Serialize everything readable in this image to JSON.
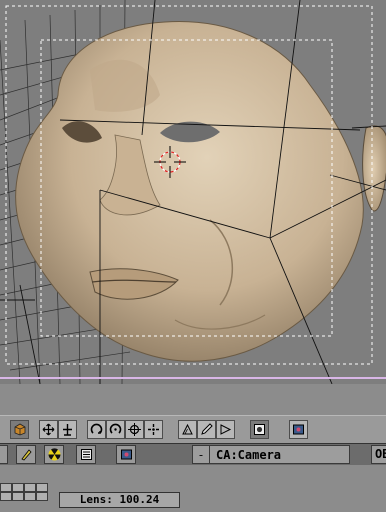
{
  "viewport": {
    "active_view": "camera",
    "object": "head-mesh"
  },
  "toolbar": {
    "icons": [
      "object-cube-icon",
      "grab-move-icon",
      "scale-icon",
      "rotate-icon",
      "rotate-local-icon",
      "center-icon",
      "snap-icon",
      "proportional-icon",
      "pencil-icon",
      "wedge-icon",
      "render-icon",
      "image-icon"
    ]
  },
  "infobar": {
    "dash_label": "-",
    "camera_name": "CA:Camera",
    "ob_label": "OB"
  },
  "panel": {
    "lens_label": "Lens: 100.24"
  },
  "colors": {
    "viewport_bg": "#7e7e7e",
    "skin": "#cdb99c",
    "grid_line": "#222222",
    "cursor": "#e02020",
    "border_accent": "#d8b6e6"
  }
}
